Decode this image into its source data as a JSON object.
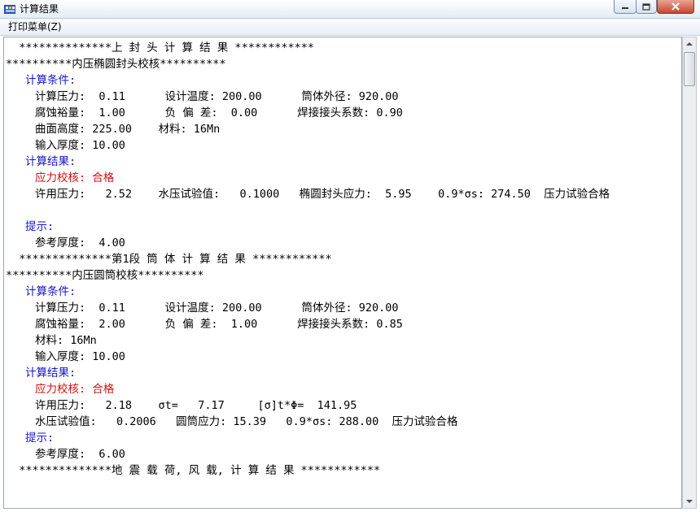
{
  "window": {
    "title": "计算结果",
    "icon": "calc-results-app-icon"
  },
  "menu": {
    "print_label": "打印菜单(Z)"
  },
  "colors": {
    "heading_blue": "#1515c8",
    "check_red": "#d21010"
  },
  "lines": [
    {
      "text": "  **************上 封 头 计 算 结 果 ************",
      "style": "normal",
      "indent": 0
    },
    {
      "text": "**********内压椭圆封头校核**********",
      "style": "normal",
      "indent": 0
    },
    {
      "text": "计算条件:",
      "style": "blue",
      "indent": 2
    },
    {
      "text": "计算压力:  0.11      设计温度: 200.00      筒体外径: 920.00",
      "style": "normal",
      "indent": 3
    },
    {
      "text": "腐蚀裕量:  1.00      负 偏 差:  0.00      焊接接头系数: 0.90",
      "style": "normal",
      "indent": 3
    },
    {
      "text": "曲面高度: 225.00    材料: 16Mn",
      "style": "normal",
      "indent": 3
    },
    {
      "text": "输入厚度: 10.00",
      "style": "normal",
      "indent": 3
    },
    {
      "text": "计算结果:",
      "style": "blue",
      "indent": 2
    },
    {
      "text": "应力校核: 合格",
      "style": "red",
      "indent": 3
    },
    {
      "text": "许用压力:   2.52    水压试验值:   0.1000   椭圆封头应力:  5.95    0.9*σs: 274.50  压力试验合格",
      "style": "normal",
      "indent": 3
    },
    {
      "text": "",
      "style": "normal",
      "indent": 0
    },
    {
      "text": "提示:",
      "style": "blue",
      "indent": 2
    },
    {
      "text": "参考厚度:  4.00",
      "style": "normal",
      "indent": 3
    },
    {
      "text": "  **************第1段 筒 体 计 算 结 果 ************",
      "style": "normal",
      "indent": 0
    },
    {
      "text": "**********内压圆筒校核**********",
      "style": "normal",
      "indent": 0
    },
    {
      "text": "计算条件:",
      "style": "blue",
      "indent": 2
    },
    {
      "text": "计算压力:  0.11      设计温度: 200.00      筒体外径: 920.00",
      "style": "normal",
      "indent": 3
    },
    {
      "text": "腐蚀裕量:  2.00      负 偏 差:  1.00      焊接接头系数: 0.85",
      "style": "normal",
      "indent": 3
    },
    {
      "text": "材料: 16Mn",
      "style": "normal",
      "indent": 3
    },
    {
      "text": "输入厚度: 10.00",
      "style": "normal",
      "indent": 3
    },
    {
      "text": "计算结果:",
      "style": "blue",
      "indent": 2
    },
    {
      "text": "应力校核: 合格",
      "style": "red",
      "indent": 3
    },
    {
      "text": "许用压力:   2.18    σt=   7.17     [σ]t*Φ=  141.95",
      "style": "normal",
      "indent": 3
    },
    {
      "text": "水压试验值:   0.2006   圆筒应力: 15.39   0.9*σs: 288.00  压力试验合格",
      "style": "normal",
      "indent": 3
    },
    {
      "text": "提示:",
      "style": "blue",
      "indent": 2
    },
    {
      "text": "参考厚度:  6.00",
      "style": "normal",
      "indent": 3
    },
    {
      "text": "  **************地 震 载 荷, 风 载, 计 算 结 果 ************",
      "style": "normal",
      "indent": 0
    }
  ]
}
